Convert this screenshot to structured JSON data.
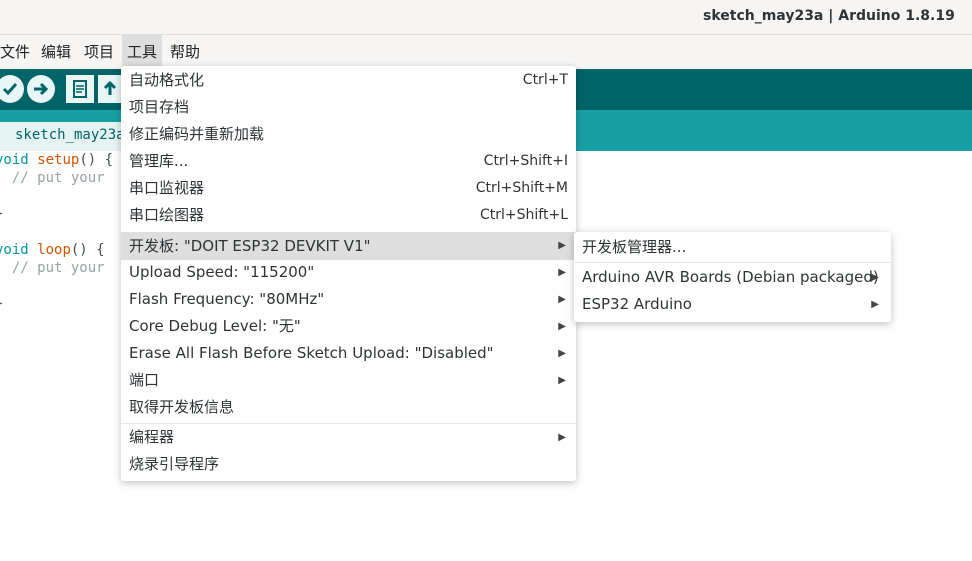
{
  "window": {
    "title": "sketch_may23a | Arduino 1.8.19"
  },
  "menubar": {
    "file": "文件",
    "edit": "编辑",
    "project": "项目",
    "tools": "工具",
    "help": "帮助"
  },
  "toolbar": {
    "verify_icon": "checkmark-icon",
    "upload_icon": "arrow-right-icon",
    "new_icon": "document-icon",
    "open_icon": "arrow-up-icon"
  },
  "tab": {
    "label": "sketch_may23a"
  },
  "editor": {
    "line1": {
      "type": "void",
      "fn": "setup",
      "rest": "() {"
    },
    "line2": "  // put your",
    "line3": "}",
    "line4": {
      "type": "void",
      "fn": "loop",
      "rest": "() {"
    },
    "line5": "  // put your",
    "line6": "}"
  },
  "tools_menu": {
    "items": [
      {
        "label": "自动格式化",
        "shortcut": "Ctrl+T"
      },
      {
        "label": "项目存档",
        "shortcut": ""
      },
      {
        "label": "修正编码并重新加载",
        "shortcut": ""
      },
      {
        "label": "管理库...",
        "shortcut": "Ctrl+Shift+I"
      },
      {
        "label": "串口监视器",
        "shortcut": "Ctrl+Shift+M"
      },
      {
        "label": "串口绘图器",
        "shortcut": "Ctrl+Shift+L"
      },
      {
        "label": "开发板: \"DOIT ESP32 DEVKIT V1\"",
        "shortcut": ""
      },
      {
        "label": "Upload Speed: \"115200\"",
        "shortcut": ""
      },
      {
        "label": "Flash Frequency: \"80MHz\"",
        "shortcut": ""
      },
      {
        "label": "Core Debug Level: \"无\"",
        "shortcut": ""
      },
      {
        "label": "Erase All Flash Before Sketch Upload: \"Disabled\"",
        "shortcut": ""
      },
      {
        "label": "端口",
        "shortcut": ""
      },
      {
        "label": "取得开发板信息",
        "shortcut": ""
      },
      {
        "label": "编程器",
        "shortcut": ""
      },
      {
        "label": "烧录引导程序",
        "shortcut": ""
      }
    ]
  },
  "board_submenu": {
    "items": [
      {
        "label": "开发板管理器..."
      },
      {
        "label": "Arduino AVR Boards (Debian packaged)"
      },
      {
        "label": "ESP32 Arduino"
      }
    ]
  },
  "colors": {
    "toolbar": "#006468",
    "tabstrip": "#17a1a5",
    "highlight": "#dedede"
  }
}
